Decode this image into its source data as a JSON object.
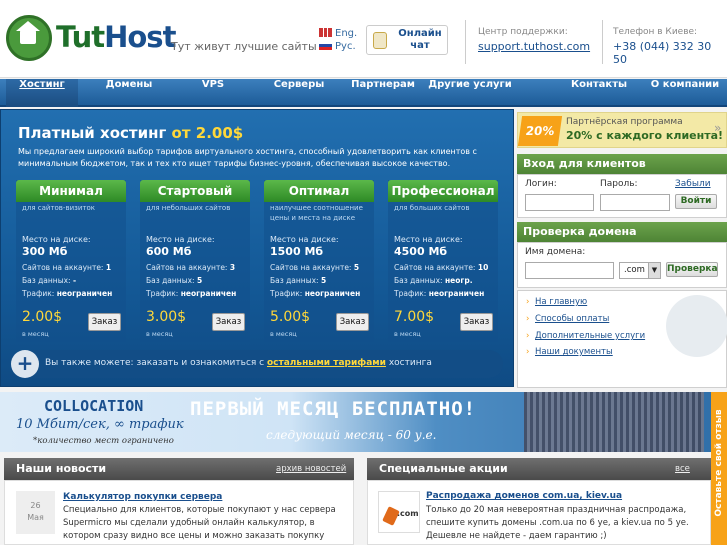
{
  "header": {
    "logo_text_a": "Tut",
    "logo_text_b": "Host",
    "tagline": "Тут живут лучшие сайты",
    "lang_en": "Eng.",
    "lang_ru": "Рус.",
    "chat_label": "Онлайн чат",
    "support_label": "Центр поддержки:",
    "support_value": "support.tuthost.com",
    "phone_label": "Телефон в Киеве:",
    "phone_value": "+38 (044) 332 30 50"
  },
  "nav": {
    "items": [
      "Хостинг",
      "Домены",
      "VPS",
      "Серверы",
      "Партнерам",
      "Другие услуги",
      "Контакты",
      "О компании"
    ]
  },
  "hosting": {
    "title": "Платный хостинг",
    "title_price": "от 2.00$",
    "description": "Мы предлагаем широкий выбор тарифов виртуального хостинга, способный удовлетворить как клиентов с минимальным бюджетом, так и тех кто ищет тарифы бизнес-уровня, обеспечивая высокое качество.",
    "disk_label": "Место на диске:",
    "sites_label": "Сайтов на аккаунте:",
    "db_label": "Баз данных:",
    "traffic_label": "Трафик:",
    "per_month": "в месяц",
    "order_label": "Заказ",
    "plans": [
      {
        "name": "Минимал",
        "sub": "для сайтов-визиток",
        "disk": "300 Мб",
        "sites": "1",
        "db": "-",
        "traffic": "неограничен",
        "price": "2.00$"
      },
      {
        "name": "Стартовый",
        "sub": "для небольших сайтов",
        "disk": "600 Мб",
        "sites": "3",
        "db": "5",
        "traffic": "неограничен",
        "price": "3.00$"
      },
      {
        "name": "Оптимал",
        "sub": "наилучшее соотношение цены и места на диске",
        "disk": "1500 Мб",
        "sites": "5",
        "db": "5",
        "traffic": "неограничен",
        "price": "5.00$"
      },
      {
        "name": "Профессионал",
        "sub": "для больших сайтов",
        "disk": "4500 Мб",
        "sites": "10",
        "db": "неогр.",
        "traffic": "неограничен",
        "price": "7.00$"
      }
    ],
    "also_text_a": "Вы также можете: заказать и ознакомиться с",
    "also_link": "остальными тарифами",
    "also_text_b": "хостинга"
  },
  "partner": {
    "percent": "20%",
    "small": "Партнёрская программа",
    "big": "20% с каждого клиента!",
    "arrow": "»"
  },
  "login": {
    "title": "Вход для клиентов",
    "login_label": "Логин:",
    "password_label": "Пароль:",
    "forgot": "Забыли",
    "submit": "Войти"
  },
  "domain_check": {
    "title": "Проверка домена",
    "label": "Имя домена:",
    "zone": ".com",
    "submit": "Проверка"
  },
  "links": [
    "На главную",
    "Способы оплаты",
    "Дополнительные услуги",
    "Наши документы"
  ],
  "banner": {
    "colo_title": "COLLOCATION",
    "colo_speed": "10 Мбит/сек, ∞ трафик",
    "colo_note": "*количество мест ограничено",
    "free_title": "ПЕРВЫЙ МЕСЯЦ БЕСПЛАТНО!",
    "free_sub": "следующий месяц - 60 у.е."
  },
  "side_tab": "Оставьте свой отзыв",
  "news": {
    "title": "Наши новости",
    "archive": "архив новостей",
    "day": "26",
    "month": "Мая",
    "item_title": "Калькулятор покупки сервера",
    "item_text": "Специально для клиентов, которые покупают у нас сервера Supermicro мы сделали удобный онлайн калькулятор, в котором сразу видно все цены и можно заказать покупку сервера."
  },
  "promos": {
    "title": "Специальные акции",
    "all": "все акци",
    "icon_text": ".com",
    "item_title": "Распродажа доменов com.ua, kiev.ua",
    "item_text": "Только до 20 мая невероятная праздничная распродажа, спешите купить домены .com.ua по 6 уе, а kiev.ua по 5 уе. Дешевле не найдете - даем гарантию ;)"
  },
  "colors": {
    "brand_blue": "#1a4f8d",
    "brand_green": "#4a9a3c",
    "accent_orange": "#f7a218",
    "price_yellow": "#ffd83a"
  }
}
